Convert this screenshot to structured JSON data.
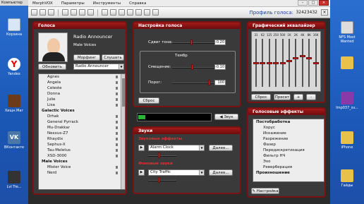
{
  "desktop": {
    "top_cut": "Компьютер",
    "left_icons": [
      "Корзина",
      "Yandex",
      "Хищн.Маг",
      "ВКонтакте",
      "Lvl Tre..."
    ],
    "right_icons": [
      "NFS Most Wanted",
      "",
      "Imp037_sv...",
      "iPhone",
      "Гайды"
    ]
  },
  "menubar": [
    "MorphVOX",
    "Параметры",
    "Инструменты",
    "Справка"
  ],
  "toolbar": {
    "profile_label": "Профиль голоса:",
    "profile_value": "32423432"
  },
  "voices": {
    "title": "Голоса",
    "selected_name": "Radio Announcer",
    "selected_category": "Male Voices",
    "morph_label": "Морфинг",
    "listen_label": "Слушать",
    "update_label": "Обновить",
    "dropdown_value": "Radio Announcer",
    "list": [
      {
        "label": "Agnes",
        "group": false
      },
      {
        "label": "Angela",
        "group": false
      },
      {
        "label": "Celeste",
        "group": false
      },
      {
        "label": "Donna",
        "group": false
      },
      {
        "label": "Julie",
        "group": false
      },
      {
        "label": "Lisa",
        "group": false
      },
      {
        "label": "Galactic Voices",
        "group": true
      },
      {
        "label": "Drhak",
        "group": false
      },
      {
        "label": "General Pyrrack",
        "group": false
      },
      {
        "label": "Mu-Drakkar",
        "group": false
      },
      {
        "label": "Nexxus-Z7",
        "group": false
      },
      {
        "label": "Rhaydix",
        "group": false
      },
      {
        "label": "Sephus-X",
        "group": false
      },
      {
        "label": "Tau-Meletus",
        "group": false
      },
      {
        "label": "XSD-3000",
        "group": false
      },
      {
        "label": "Male Voices",
        "group": true
      },
      {
        "label": "Mister Voice",
        "group": false
      },
      {
        "label": "Nerd",
        "group": false
      }
    ]
  },
  "settings": {
    "title": "Настройка голоса",
    "pitch_label": "Сдвиг тона:",
    "pitch_value": "-0.20",
    "pitch_level": 0.45,
    "timbre_group": "Тембр",
    "shift_label": "Смещение:",
    "shift_value": "-0.10",
    "shift_level": 0.47,
    "threshold_label": "Порог:",
    "threshold_value": "100",
    "threshold_level": 0.9,
    "reset_label": "Сброс"
  },
  "meter": {
    "level": 0.1,
    "mute_label": "Звук"
  },
  "sounds": {
    "title": "Звуки",
    "effects_label": "Звуковые эффекты",
    "effect_value": "Alarm Clock",
    "more1_label": "Далее...",
    "bg_label": "Фоновые звуки",
    "bg_value": "City Traffic",
    "more2_label": "Далее..."
  },
  "equalizer": {
    "title": "Графический эквалайзер",
    "bands": [
      "31",
      "62",
      "125",
      "250",
      "500",
      "1K",
      "2K",
      "4K",
      "8K",
      "16K"
    ],
    "levels": [
      0.5,
      0.5,
      0.5,
      0.5,
      0.5,
      0.55,
      0.6,
      0.65,
      0.6,
      0.5
    ],
    "reset_label": "Сброс",
    "preset_label": "Пресет",
    "plus_label": "+",
    "minus_label": "-"
  },
  "effects": {
    "title": "Голосовые эффекты",
    "list": [
      {
        "label": "Постобработка",
        "group": true
      },
      {
        "label": "Хорус",
        "group": false
      },
      {
        "label": "Искажение",
        "group": false
      },
      {
        "label": "Разрежение",
        "group": false
      },
      {
        "label": "Фазер",
        "group": false
      },
      {
        "label": "Передискретизация",
        "group": false
      },
      {
        "label": "Фильтр НЧ",
        "group": false
      },
      {
        "label": "Эхо",
        "group": false
      },
      {
        "label": "Реверберация",
        "group": false
      },
      {
        "label": "Произношение",
        "group": true
      }
    ],
    "settings_label": "Настройка"
  }
}
